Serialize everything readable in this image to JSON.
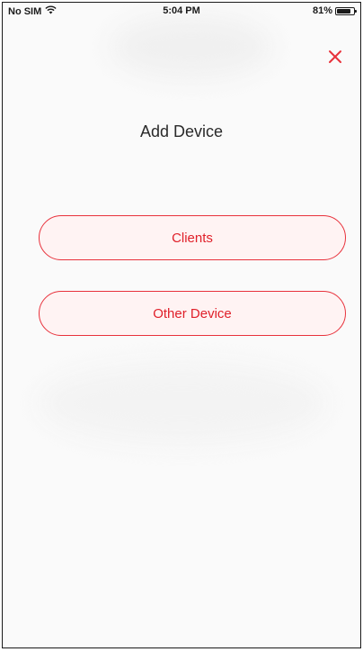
{
  "status_bar": {
    "carrier": "No SIM",
    "time": "5:04 PM",
    "battery_text": "81%",
    "battery_level": 0.81
  },
  "header": {
    "title": "Add Device",
    "close_icon": "close-icon"
  },
  "options": [
    {
      "label": "Clients"
    },
    {
      "label": "Other Device"
    }
  ],
  "colors": {
    "accent": "#e8323c",
    "button_bg": "#fff3f3",
    "background": "#fafafa",
    "title_text": "#2a2a2a"
  }
}
